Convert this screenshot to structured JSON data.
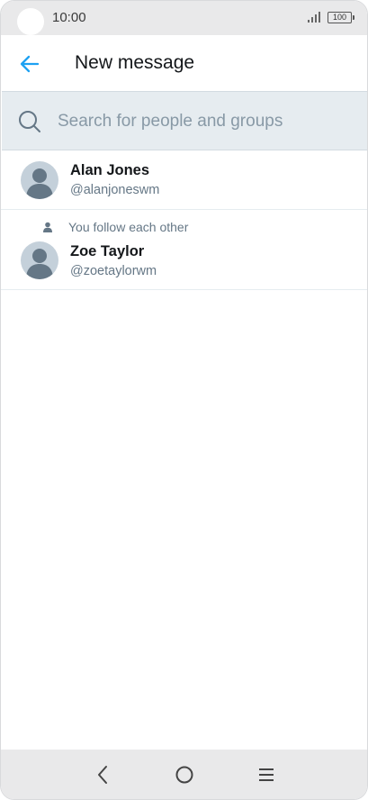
{
  "status_bar": {
    "time": "10:00",
    "battery": "100",
    "icons": [
      "signal-icon",
      "battery-icon"
    ]
  },
  "header": {
    "back_icon": "arrow-left-icon",
    "title": "New message",
    "accent_color": "#1da1f2"
  },
  "search": {
    "placeholder": "Search for people and groups",
    "value": "",
    "icon": "search-icon"
  },
  "contacts": [
    {
      "name": "Alan Jones",
      "handle": "@alanjoneswm",
      "social_context": ""
    },
    {
      "name": "Zoe Taylor",
      "handle": "@zoetaylorwm",
      "social_context": "You follow each other"
    }
  ],
  "nav_bar": {
    "buttons": [
      "back-icon",
      "home-icon",
      "menu-icon"
    ]
  }
}
